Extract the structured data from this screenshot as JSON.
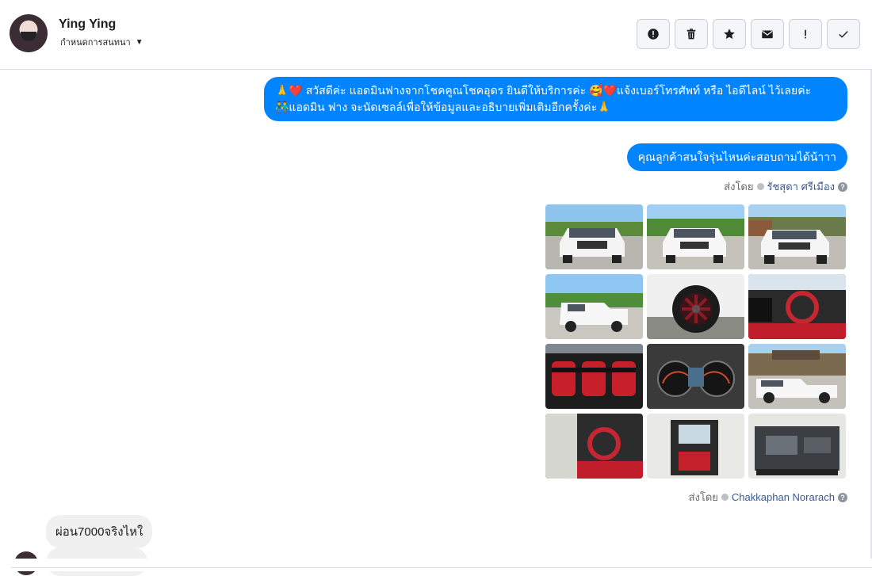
{
  "header": {
    "name": "Ying Ying",
    "subtitle": "กำหนดการสนทนา",
    "actions": [
      {
        "icon": "alert-circle-icon"
      },
      {
        "icon": "trash-icon"
      },
      {
        "icon": "star-icon"
      },
      {
        "icon": "mail-icon"
      },
      {
        "icon": "exclamation-icon"
      },
      {
        "icon": "check-icon"
      }
    ]
  },
  "messages": {
    "out1_line1": "🙏❤️ สวัสดีค่ะ แอดมินฟางจากโชคคูณโชคอุดร ยินดีให้บริการค่ะ 🥰❤️แจ้งเบอร์โทรศัพท์ หรือ ไอดีไลน์ ไว้เลยค่ะ",
    "out1_line2": "👬แอดมิน ฟาง จะนัดเซลล์เพื่อให้ข้อมูลและอธิบายเพิ่มเติมอีกครั้งค่ะ🙏",
    "out2": "คุณลูกค้าสนใจรุ่นไหนค่ะสอบถามได้น้าาา",
    "meta1_prefix": "ส่งโดย",
    "meta1_name": "รัชสุดา ศรีเมือง",
    "meta2_prefix": "ส่งโดย",
    "meta2_name": "Chakkaphan Norarach",
    "in1": "ผ่อน7000จริงไหใ"
  },
  "colors": {
    "outgoing": "#0084ff",
    "incoming": "#f1f0f0",
    "link": "#385898"
  }
}
